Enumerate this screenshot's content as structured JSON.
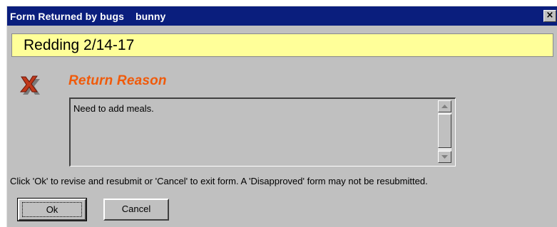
{
  "window": {
    "title": "Form Returned by bugs    bunny",
    "close_label": "×"
  },
  "banner": {
    "text": "Redding 2/14-17",
    "color": "#ffff99"
  },
  "reason": {
    "icon": "red-x-icon",
    "heading": "Return Reason",
    "heading_color": "#f05a0a",
    "text": "Need to add meals."
  },
  "instructions": "Click 'Ok' to revise and resubmit or 'Cancel' to exit form. A 'Disapproved' form may not be resubmitted.",
  "buttons": {
    "ok_label": "Ok",
    "cancel_label": "Cancel"
  },
  "colors": {
    "titlebar": "#0a1e7d",
    "dialog_bg": "#c0c0c0"
  }
}
